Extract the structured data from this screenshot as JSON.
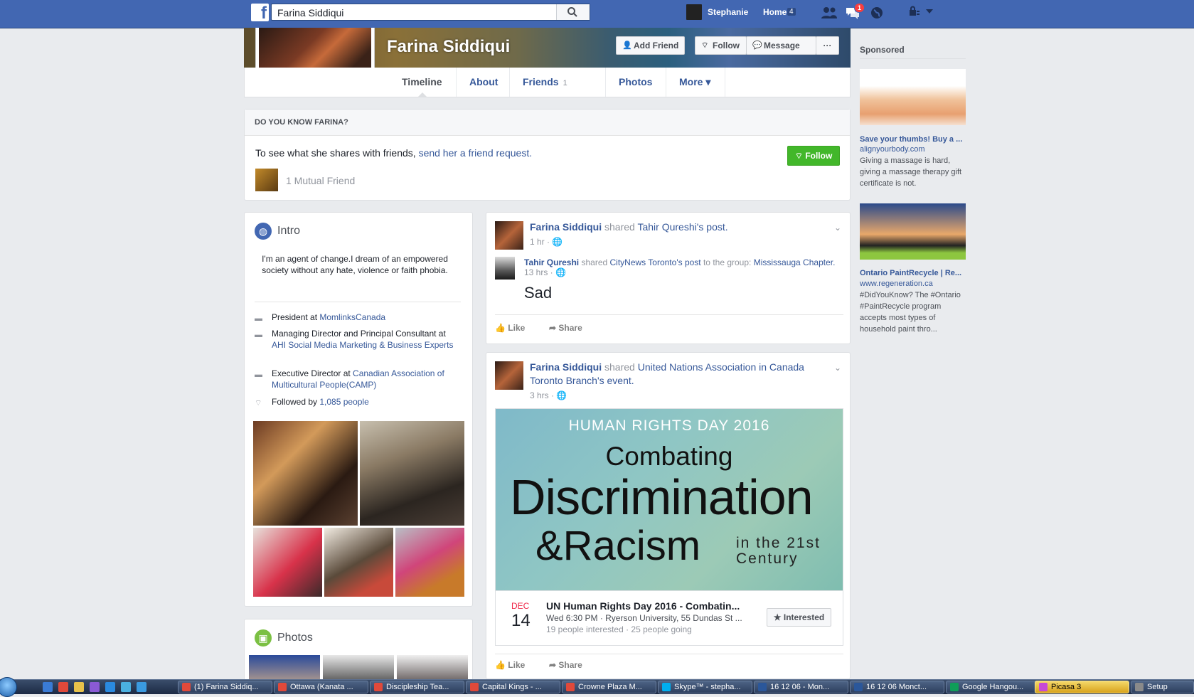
{
  "topbar": {
    "search_value": "Farina Siddiqui",
    "user_name": "Stephanie",
    "home_label": "Home",
    "home_count": "4",
    "notification_count": "1"
  },
  "profile": {
    "name": "Farina Siddiqui",
    "buttons": {
      "add_friend": "Add Friend",
      "follow": "Follow",
      "message": "Message",
      "more": "···"
    },
    "tabs": [
      {
        "label": "Timeline"
      },
      {
        "label": "About"
      },
      {
        "label": "Friends",
        "sub": "1 Mutual"
      },
      {
        "label": "Photos"
      },
      {
        "label": "More ▾"
      }
    ]
  },
  "do_you_know": {
    "header": "DO YOU KNOW FARINA?",
    "text": "To see what she shares with friends,",
    "link": "send her a friend request.",
    "follow_button": "Follow",
    "mutual": "1 Mutual Friend"
  },
  "intro": {
    "title": "Intro",
    "bio": "I'm an agent of change.I dream of an empowered society without any hate, violence or faith phobia.",
    "rows": [
      {
        "prefix": "President at ",
        "link": "MomlinksCanada"
      },
      {
        "prefix": "Managing Director and Principal Consultant at ",
        "link": "AHI Social Media Marketing & Business Experts"
      },
      {
        "prefix": "Executive Director at ",
        "link": "Canadian Association of Multicultural People(CAMP)"
      },
      {
        "prefix": "Followed by ",
        "link": "1,085 people"
      }
    ]
  },
  "photos_card": {
    "title": "Photos"
  },
  "post1": {
    "author": "Farina Siddiqui",
    "shared": " shared ",
    "target": "Tahir Qureshi",
    "target_suffix": "'s post.",
    "time": "1 hr · 🌐",
    "inner_author": "Tahir Qureshi",
    "inner_shared": " shared ",
    "inner_page": "CityNews Toronto",
    "inner_post": "'s post",
    "inner_group_text": " to the group: ",
    "inner_group": "Mississauga Chapter.",
    "inner_time": "13 hrs · 🌐",
    "message": "Sad",
    "like": "Like",
    "share": "Share"
  },
  "post2": {
    "author": "Farina Siddiqui",
    "shared": " shared ",
    "target": "United Nations Association in Canada Toronto Branch",
    "target_suffix": "'s event.",
    "time": "3 hrs · 🌐",
    "event_image": {
      "line1": "HUMAN RIGHTS DAY 2016",
      "line2": "Combating",
      "line3": "Discrimination",
      "line4": "&Racism",
      "line5": "in the 21st Century"
    },
    "event": {
      "month": "DEC",
      "day": "14",
      "title": "UN Human Rights Day 2016 - Combatin...",
      "where": "Wed 6:30 PM · Ryerson University, 55 Dundas St ...",
      "stats": "19 people interested · 25 people going",
      "button": "★ Interested"
    },
    "like": "Like",
    "share": "Share"
  },
  "sponsored": {
    "title": "Sponsored",
    "ads": [
      {
        "title": "Save your thumbs! Buy a ...",
        "domain": "alignyourbody.com",
        "body": "Giving a massage is hard, giving a massage therapy gift certificate is not."
      },
      {
        "title": "Ontario PaintRecycle | Re...",
        "domain": "www.regeneration.ca",
        "body": "#DidYouKnow? The #Ontario #PaintRecycle program accepts most types of household paint thro..."
      }
    ]
  },
  "taskbar": {
    "tasks": [
      {
        "label": "(1) Farina Siddiq..."
      },
      {
        "label": "Ottawa (Kanata ..."
      },
      {
        "label": "Discipleship Tea..."
      },
      {
        "label": "Capital Kings - ..."
      },
      {
        "label": "Crowne Plaza M..."
      },
      {
        "label": "Skype™ - stepha..."
      },
      {
        "label": "16 12 06 - Mon..."
      },
      {
        "label": "16 12 06 Monct..."
      },
      {
        "label": "Google Hangou..."
      },
      {
        "label": "Picasa 3"
      },
      {
        "label": "Setup"
      }
    ]
  }
}
